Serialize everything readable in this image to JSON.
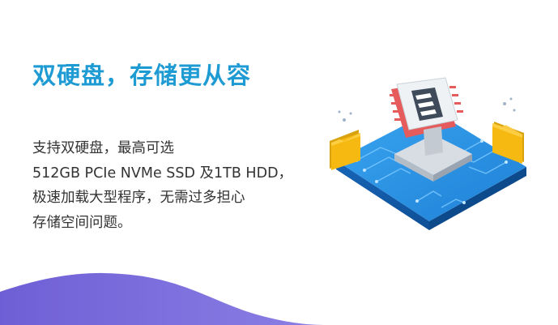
{
  "headline": "双硬盘，存储更从容",
  "description": {
    "lines": [
      "支持双硬盘，最高可选",
      "512GB PCIe NVMe SSD 及1TB HDD，",
      "极速加载大型程序，无需过多担心",
      "存储空间问题。"
    ]
  },
  "colors": {
    "headline": "#1f9bd4",
    "body_text": "#333333",
    "wave": "#7b6ddb",
    "board": "#2c93e6",
    "chip": "#e8eef2",
    "folder": "#f5b912",
    "accent_red": "#e65b5b"
  },
  "illustration_icons": [
    "storage-board-icon",
    "drive-chip-icon",
    "folder-icon-left",
    "folder-icon-right"
  ]
}
